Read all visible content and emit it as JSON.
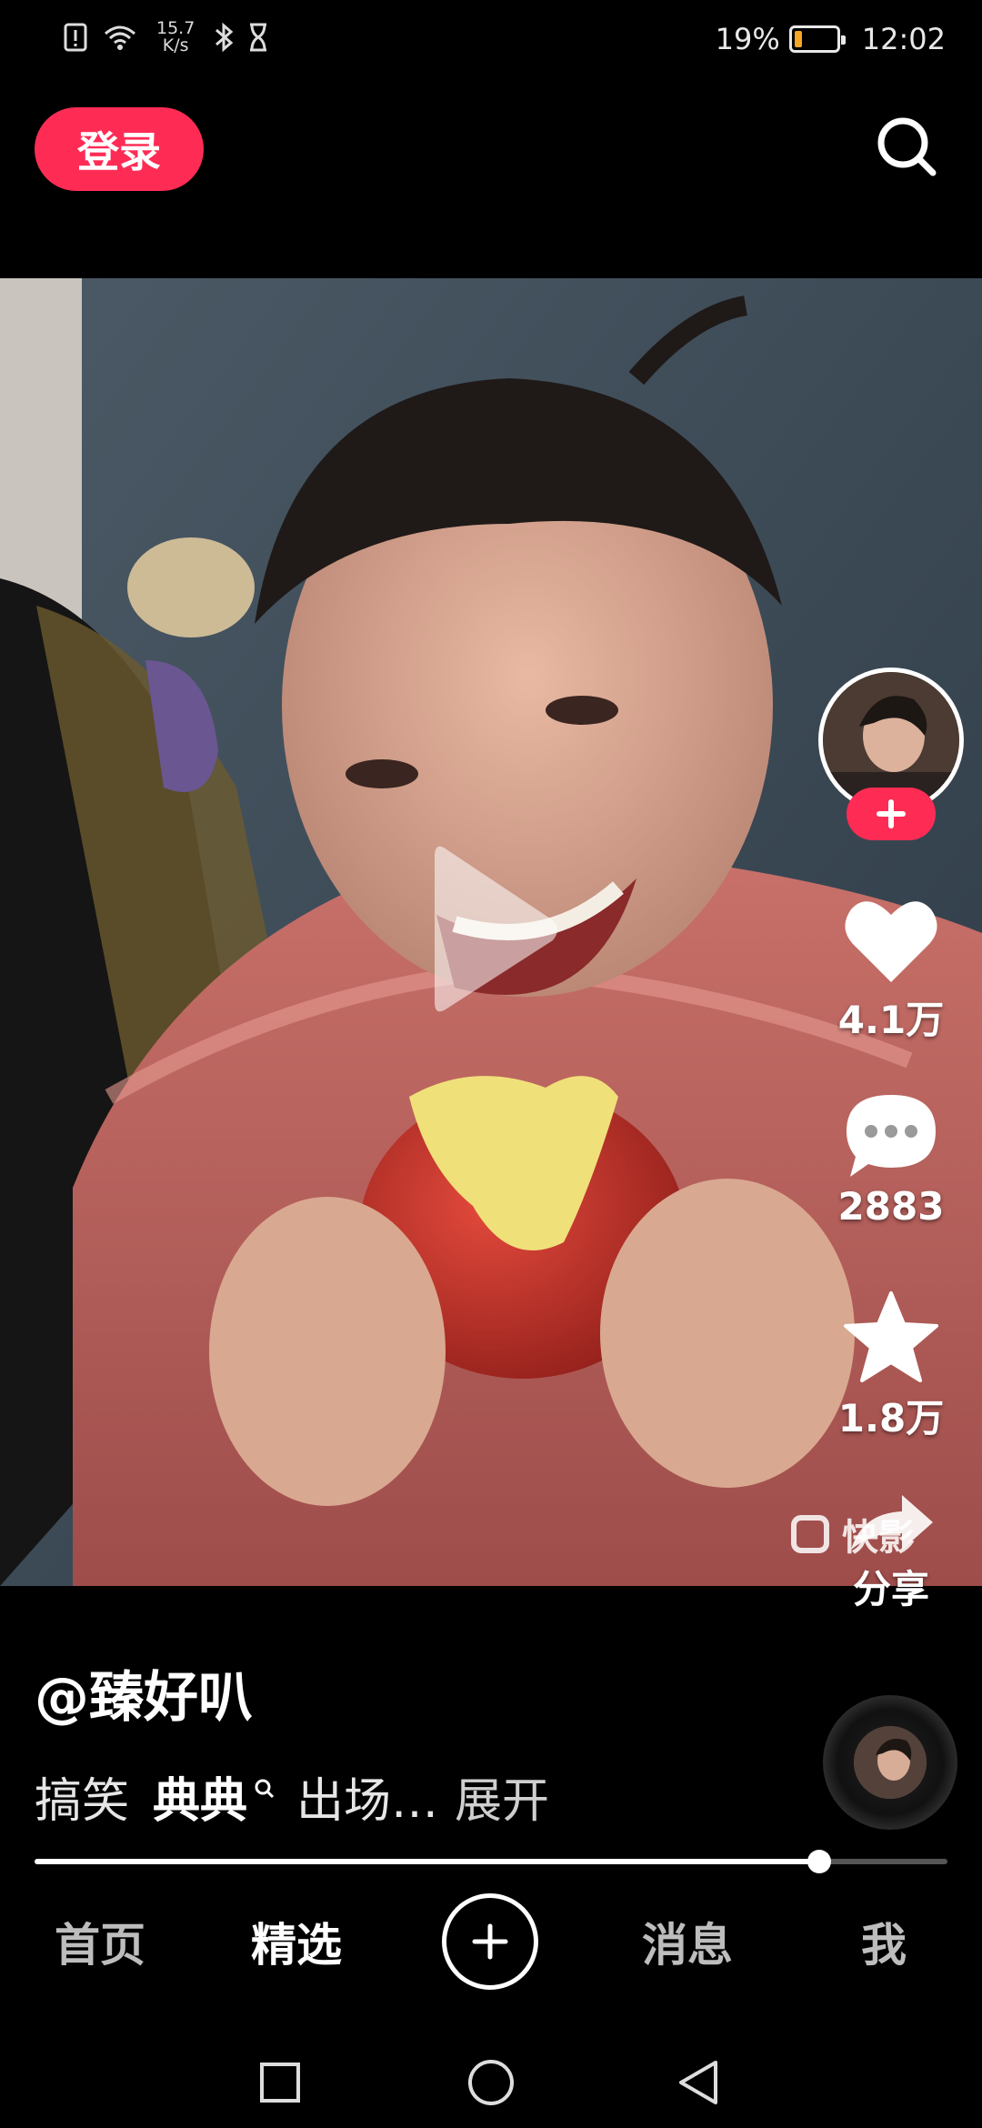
{
  "status_bar": {
    "net_speed_value": "15.7",
    "net_speed_unit": "K/s",
    "battery_percent": "19%",
    "battery_level": 0.19,
    "time": "12:02",
    "icons": [
      "sim-alert-icon",
      "wifi-icon",
      "bluetooth-icon",
      "hourglass-icon",
      "battery-icon"
    ]
  },
  "header": {
    "login_label": "登录",
    "search_icon": "search-icon"
  },
  "video": {
    "state": "paused",
    "play_icon": "play-icon",
    "watermark": "快影"
  },
  "actions": {
    "follow_icon": "plus-icon",
    "like_count": "4.1万",
    "comment_count": "2883",
    "favorite_count": "1.8万",
    "share_label": "分享"
  },
  "post": {
    "author": "@臻好叭",
    "caption_prefix": "搞笑",
    "caption_highlight": "典典",
    "caption_suffix": "出场…",
    "expand_label": "展开"
  },
  "progress": {
    "played_fraction": 0.86
  },
  "tabs": {
    "home": "首页",
    "featured": "精选",
    "publish_icon": "plus-circle-icon",
    "messages": "消息",
    "me": "我",
    "active": "featured"
  },
  "system_nav": [
    "recents-icon",
    "home-icon",
    "back-icon"
  ],
  "colors": {
    "accent": "#fe2c55",
    "background": "#000000",
    "battery_low": "#f5a623"
  }
}
